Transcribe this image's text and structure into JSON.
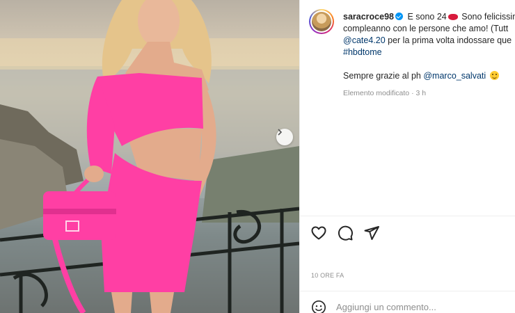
{
  "post": {
    "username": "saracroce98",
    "caption_part1": "E sono 24",
    "caption_part2": "Sono felicissim",
    "caption_line2": "compleanno con le persone che amo! (Tutt",
    "mention_cate": "@cate4.20",
    "caption_line3_rest": "per la prima volta indossare que",
    "hashtag": "#hbdtome",
    "thanks_text": "Sempre grazie al ph",
    "mention_photographer": "@marco_salvati",
    "edited_label": "Elemento modificato",
    "edited_separator": "·",
    "edited_time": "3 h"
  },
  "timestamp": "10 ORE FA",
  "comment": {
    "placeholder": "Aggiungi un commento..."
  },
  "icons": {
    "verified": "verified-badge-icon",
    "like": "heart-icon",
    "comment": "comment-bubble-icon",
    "share": "paper-plane-icon",
    "emoji": "smiley-icon",
    "next": "chevron-right-icon"
  },
  "colors": {
    "dress_pink": "#ff3fa4",
    "link_blue": "#00376b",
    "verified_blue": "#0095f6",
    "muted_text": "#8e8e8e"
  }
}
